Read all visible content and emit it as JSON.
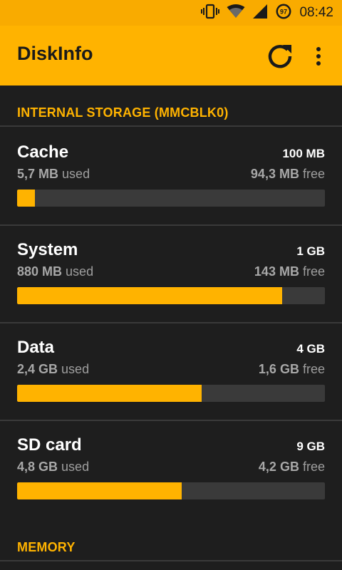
{
  "status_bar": {
    "time": "08:42",
    "battery_level": "97",
    "icons": [
      "vibrate-icon",
      "wifi-icon",
      "cell-signal-icon",
      "battery-icon"
    ]
  },
  "app_bar": {
    "title": "DiskInfo",
    "icons": [
      "refresh-icon",
      "more-vert-icon"
    ]
  },
  "colors": {
    "accent": "#ffb300",
    "status_bar": "#f9ab00",
    "background": "#1e1e1e",
    "track": "#3a3a3a"
  },
  "sections": {
    "internal": "INTERNAL STORAGE (MMCBLK0)",
    "memory": "MEMORY"
  },
  "storage": [
    {
      "name": "Cache",
      "total": "100 MB",
      "used_value": "5,7 MB",
      "used_suffix": "used",
      "free_value": "94,3 MB",
      "free_suffix": "free",
      "used_fraction": 0.057
    },
    {
      "name": "System",
      "total": "1 GB",
      "used_value": "880 MB",
      "used_suffix": "used",
      "free_value": "143 MB",
      "free_suffix": "free",
      "used_fraction": 0.86
    },
    {
      "name": "Data",
      "total": "4 GB",
      "used_value": "2,4 GB",
      "used_suffix": "used",
      "free_value": "1,6 GB",
      "free_suffix": "free",
      "used_fraction": 0.6
    },
    {
      "name": "SD card",
      "total": "9 GB",
      "used_value": "4,8 GB",
      "used_suffix": "used",
      "free_value": "4,2 GB",
      "free_suffix": "free",
      "used_fraction": 0.535
    }
  ]
}
